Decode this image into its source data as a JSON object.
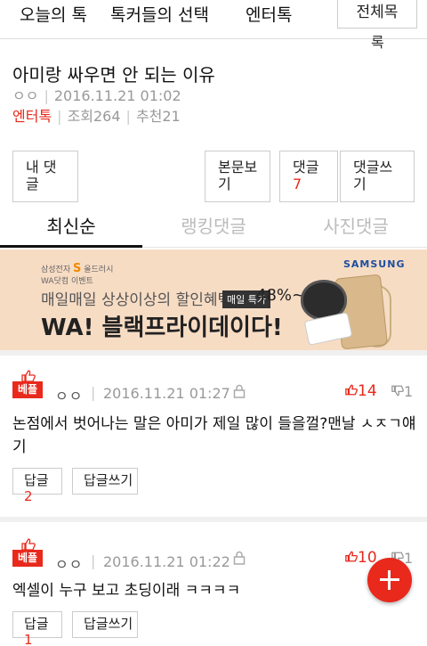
{
  "topnav": {
    "today": "오늘의 톡",
    "choice": "톡커들의 선택",
    "enter": "엔터톡",
    "all_label": "전체목록",
    "all_line1": "전체목",
    "all_line2": "록"
  },
  "article": {
    "title": "아미랑 싸우면 안 되는 이유",
    "author": "ㅇㅇ",
    "date": "2016.11.21 01:02",
    "category": "엔터톡",
    "views": "조회264",
    "recommends": "추천21"
  },
  "actions": {
    "my_comments": "내 댓글",
    "body_view": "본문보기",
    "comments": "댓글",
    "comment_count": "7",
    "write_comment": "댓글쓰기"
  },
  "tabs": [
    "최신순",
    "랭킹댓글",
    "사진댓글"
  ],
  "banner": {
    "sponsor": "삼성전자",
    "brand_s": "S",
    "sponsor2": "올드러시",
    "sub": "WA닷컴 이벤트",
    "line1": "매일매일 상상이상의 할인혜택",
    "tag": "매일 특가",
    "percent": "48%~",
    "line2": "WA! 블랙프라이데이다!",
    "brand": "SAMSUNG"
  },
  "comments": [
    {
      "badge": "베플",
      "author": "ㅇㅇ",
      "date": "2016.11.21 01:27",
      "likes": "14",
      "dislikes": "1",
      "text": "논점에서 벗어나는 말은 아미가 제일 많이 들을껄?맨날 ㅅㅈㄱ얘기",
      "reply_label": "답글",
      "reply_count": "2",
      "write_reply": "답글쓰기"
    },
    {
      "badge": "베플",
      "author": "ㅇㅇ",
      "date": "2016.11.21 01:22",
      "likes": "10",
      "dislikes": "1",
      "text": "엑셀이 누구 보고 초딩이래 ㅋㅋㅋㅋ",
      "reply_label": "답글",
      "reply_count": "1",
      "write_reply": "답글쓰기"
    }
  ],
  "colors": {
    "accent": "#e8291c",
    "banner_bg": "#f7dcc4",
    "brand": "#1d4ea0"
  },
  "icons": [
    "thumbs-up-icon",
    "thumbs-down-icon",
    "lock-icon",
    "plus-icon"
  ]
}
